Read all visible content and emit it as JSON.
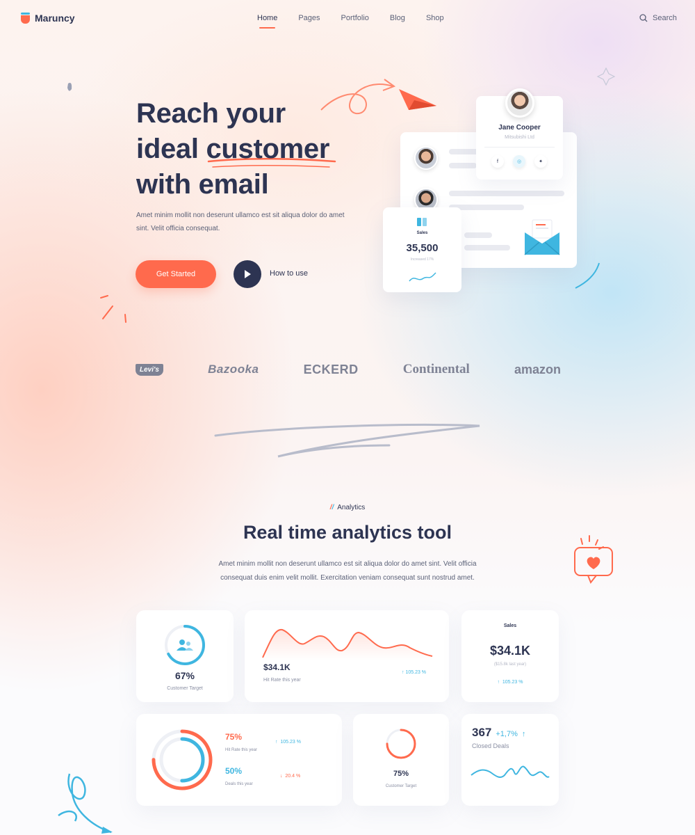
{
  "brand": {
    "name": "Maruncy"
  },
  "nav": {
    "items": [
      "Home",
      "Pages",
      "Portfolio",
      "Blog",
      "Shop"
    ],
    "active": "Home",
    "search_label": "Search"
  },
  "hero": {
    "title_lines": [
      "Reach your",
      "ideal customer",
      "with email"
    ],
    "description": "Amet minim mollit non deserunt ullamco est sit aliqua dolor do amet sint. Velit officia consequat.",
    "primary_cta": "Get Started",
    "secondary_cta": "How to use"
  },
  "hero_cards": {
    "profile": {
      "name": "Jane Cooper",
      "company": "Mitsubishi Ltd",
      "social_icons": [
        "facebook-icon",
        "instagram-icon",
        "twitter-icon"
      ]
    },
    "sales": {
      "label": "Sales",
      "value": "35,500",
      "sub": "Increased 17%"
    }
  },
  "logos": [
    "Levi's",
    "Bazooka",
    "ECKERD",
    "Continental",
    "amazon"
  ],
  "analytics": {
    "kicker": "Analytics",
    "title": "Real time analytics tool",
    "description": "Amet minim mollit non deserunt ullamco est sit aliqua dolor do amet sint. Velit officia consequat duis enim velit mollit. Exercitation veniam consequat sunt nostrud amet.",
    "cards": {
      "customer_target": {
        "value": "67%",
        "label": "Customer Target",
        "progress": 0.67
      },
      "hit_rate": {
        "value": "$34.1K",
        "label": "Hit Rate this year",
        "change": "105.23 %"
      },
      "sales": {
        "title": "Sales",
        "value": "$34.1K",
        "sub": "($15.8k last year)",
        "change": "105.23 %"
      },
      "rings": {
        "hit_rate": {
          "value": "75%",
          "label": "Hit Rate this year",
          "change": "105.23 %"
        },
        "deals": {
          "value": "50%",
          "label": "Deals this year",
          "change": "20.4 %"
        }
      },
      "customer_target_2": {
        "value": "75%",
        "label": "Customer Target",
        "progress": 0.75
      },
      "closed_deals": {
        "value": "367",
        "change": "+1,7%",
        "label": "Closed Deals"
      }
    }
  },
  "colors": {
    "accent": "#ff6a4d",
    "secondary": "#3fb6e0",
    "text": "#2d3452"
  }
}
